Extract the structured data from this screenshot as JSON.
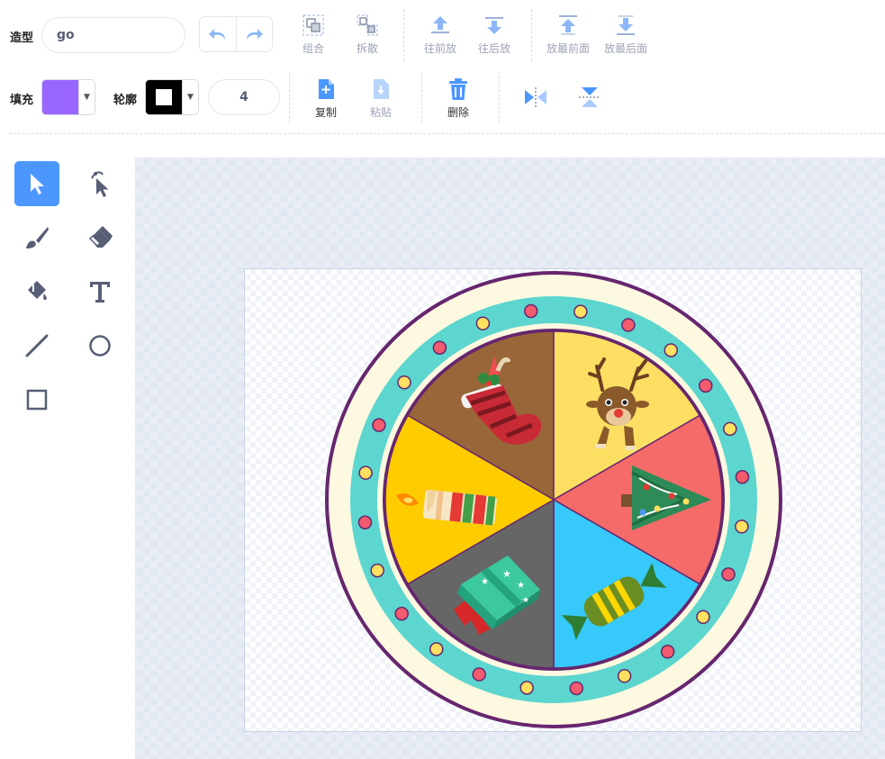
{
  "toolbar": {
    "costume_label": "造型",
    "costume_name": "go",
    "fill_label": "填充",
    "outline_label": "轮廓",
    "outline_width": "4",
    "fill_color": "#9966ff",
    "outline_color": "#000000",
    "actions_row1": {
      "group": "组合",
      "ungroup": "拆散",
      "forward": "往前放",
      "backward": "往后放",
      "front": "放最前面",
      "back": "放最后面"
    },
    "actions_row2": {
      "copy": "复制",
      "paste": "粘贴",
      "delete": "删除"
    }
  },
  "tools": [
    "select",
    "reshape",
    "brush",
    "eraser",
    "fill",
    "text",
    "line",
    "circle",
    "rectangle"
  ],
  "selected_tool": "select",
  "wheel": {
    "segments": [
      "stocking",
      "reindeer",
      "christmas-tree",
      "candy",
      "gift",
      "candle"
    ],
    "colors": {
      "stocking": "#99663a",
      "reindeer": "#fcdf62",
      "christmas-tree": "#f46b69",
      "candy": "#36c9f9",
      "gift": "#666666",
      "candle": "#ffcc00",
      "ring": "#5cd6cf",
      "cream": "#fdf8e0",
      "outline": "#66266e",
      "dot_red": "#f35b6e",
      "dot_yellow": "#fee060"
    }
  }
}
